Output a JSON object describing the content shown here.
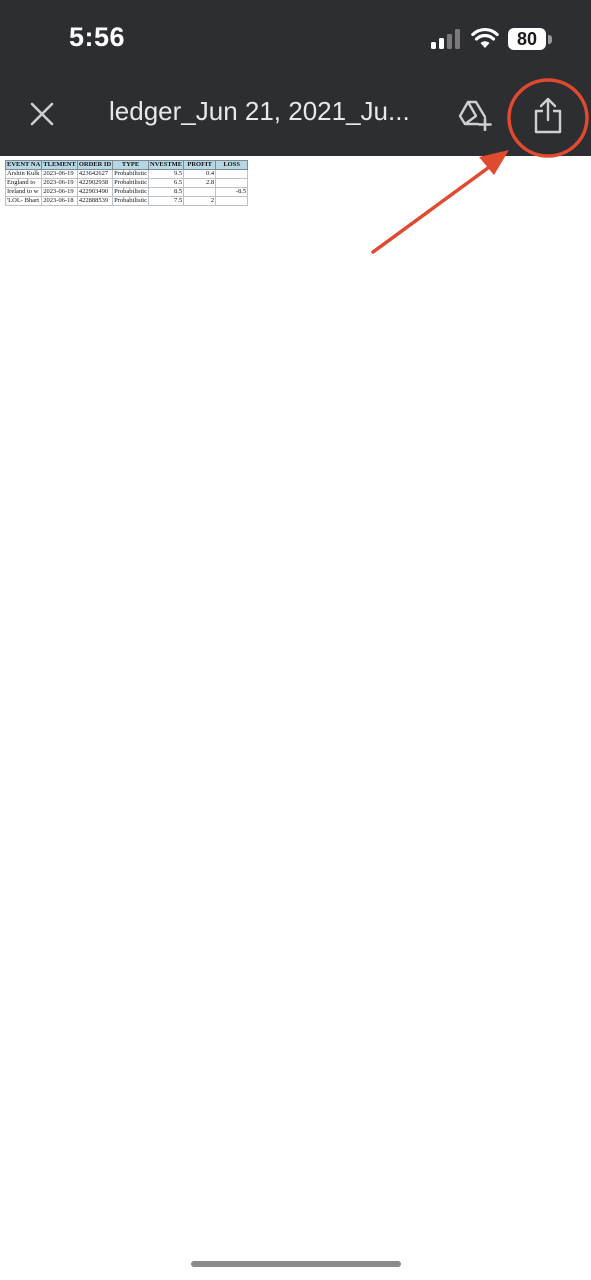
{
  "status_bar": {
    "time": "5:56",
    "battery": "80"
  },
  "toolbar": {
    "title": "ledger_Jun 21, 2021_Ju...",
    "close_icon": "close-icon",
    "drive_icon": "add-to-drive-icon",
    "share_icon": "share-icon"
  },
  "annotation": {
    "color": "#e04a2f",
    "target": "share-button"
  },
  "sheet": {
    "headers": [
      "EVENT NA",
      "TLEMENT",
      "ORDER ID",
      "TYPE",
      "NVESTME",
      "PROFIT",
      "LOSS"
    ],
    "rows": [
      [
        "Arshin Kulk",
        "2023-06-19",
        "423642627",
        "Probabilistic",
        "9.5",
        "0.4",
        ""
      ],
      [
        "England to",
        "2023-06-19",
        "422902938",
        "Probabilistic",
        "6.5",
        "2.8",
        ""
      ],
      [
        "Ireland to w",
        "2023-06-19",
        "422903490",
        "Probabilistic",
        "8.5",
        "",
        "-8.5"
      ],
      [
        "'LOL- Bhart",
        "2023-06-18",
        "422888539",
        "Probabilistic",
        "7.5",
        "2",
        ""
      ]
    ]
  }
}
